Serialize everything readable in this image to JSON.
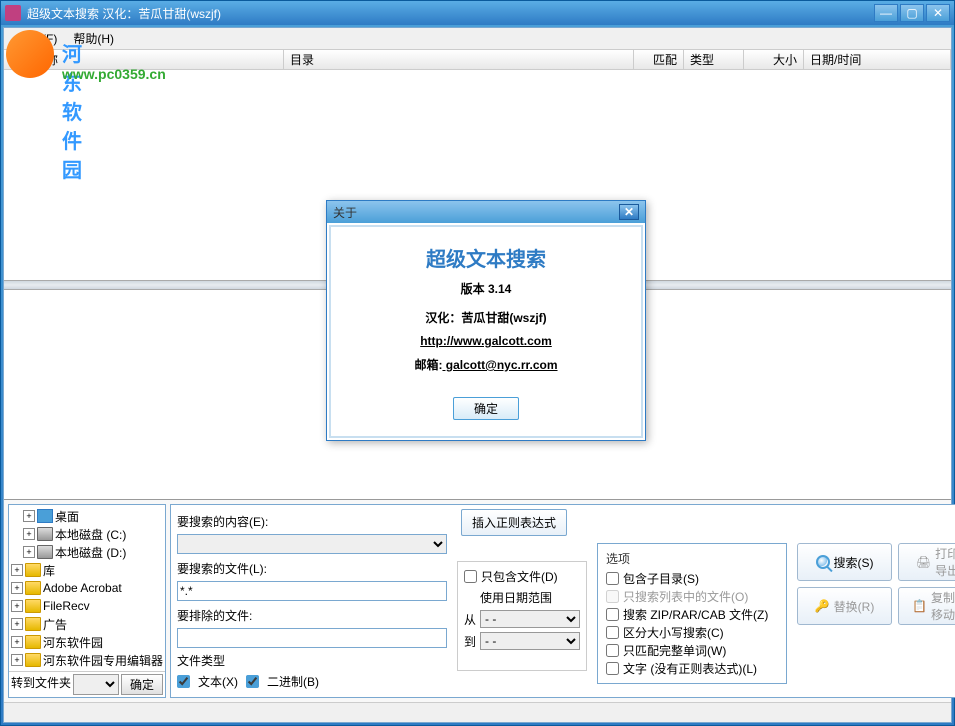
{
  "window": {
    "title": "超级文本搜索   汉化：苦瓜甘甜(wszjf)",
    "watermark_text": "河东软件园",
    "watermark_url": "www.pc0359.cn"
  },
  "menu": {
    "file": "文件(F)",
    "help": "帮助(H)"
  },
  "columns": {
    "filename": "文件名称",
    "directory": "目录",
    "match": "匹配",
    "type": "类型",
    "size": "大小",
    "datetime": "日期/时间"
  },
  "tree": {
    "items": [
      {
        "label": "桌面",
        "icon": "monitor",
        "indent": 1
      },
      {
        "label": "本地磁盘 (C:)",
        "icon": "drive",
        "indent": 1
      },
      {
        "label": "本地磁盘 (D:)",
        "icon": "drive",
        "indent": 1
      },
      {
        "label": "库",
        "icon": "folder",
        "indent": 0
      },
      {
        "label": "Adobe Acrobat",
        "icon": "folder",
        "indent": 0
      },
      {
        "label": "FileRecv",
        "icon": "folder",
        "indent": 0
      },
      {
        "label": "广告",
        "icon": "folder",
        "indent": 0
      },
      {
        "label": "河东软件园",
        "icon": "folder",
        "indent": 0
      },
      {
        "label": "河东软件园专用编辑器",
        "icon": "folder",
        "indent": 0
      }
    ],
    "goto_label": "转到文件夹",
    "goto_btn": "确定"
  },
  "search": {
    "content_label": "要搜索的内容(E):",
    "files_label": "要搜索的文件(L):",
    "files_value": "*.*",
    "exclude_label": "要排除的文件:",
    "exclude_value": "",
    "filetype_label": "文件类型",
    "filetype_text": "文本(X)",
    "filetype_binary": "二进制(B)",
    "insert_regex": "插入正则表达式",
    "only_files": "只包含文件(D)",
    "use_daterange": "使用日期范围",
    "from_label": "从",
    "to_label": "到",
    "date_placeholder": "-   -"
  },
  "options": {
    "title": "选项",
    "subdirs": "包含子目录(S)",
    "only_listed": "只搜索列表中的文件(O)",
    "search_zip": "搜索 ZIP/RAR/CAB 文件(Z)",
    "case_sensitive": "区分大小写搜索(C)",
    "whole_words": "只匹配完整单词(W)",
    "literal": "文字 (没有正则表达式)(L)"
  },
  "actions": {
    "search": "搜索(S)",
    "print": "打印/\n导出(P)",
    "replace": "替换(R)",
    "copy": "复制或\n移动文件"
  },
  "about": {
    "title": "关于",
    "heading": "超级文本搜索",
    "version": "版本 3.14",
    "translator": "汉化：苦瓜甘甜(wszjf)",
    "url": "http://www.galcott.com",
    "email_label": "邮箱:",
    "email": " galcott@nyc.rr.com",
    "ok": "确定"
  }
}
